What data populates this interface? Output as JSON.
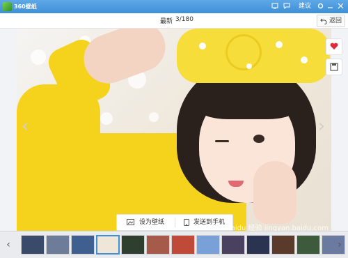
{
  "app": {
    "title": "360壁纸"
  },
  "title_bar": {
    "feedback_label": "建议"
  },
  "toolbar": {
    "sort_label": "最新",
    "counter": "3/180"
  },
  "actions": {
    "set_wallpaper": "设为壁纸",
    "send_to_phone": "发送到手机"
  },
  "thumbnails": {
    "count": 13,
    "selected_index": 3,
    "colors": [
      "#3a4a6a",
      "#6c7c99",
      "#3e5f8f",
      "#f0e6d8",
      "#2f3f2f",
      "#a55a4a",
      "#c04a3a",
      "#7aa0d8",
      "#4a4060",
      "#2a3350",
      "#5a3a2a",
      "#3d5a3d",
      "#6a7aa0"
    ]
  },
  "colors": {
    "accent": "#3f8fd6",
    "favorite": "#e02a3a",
    "dress": "#f5d21c"
  }
}
